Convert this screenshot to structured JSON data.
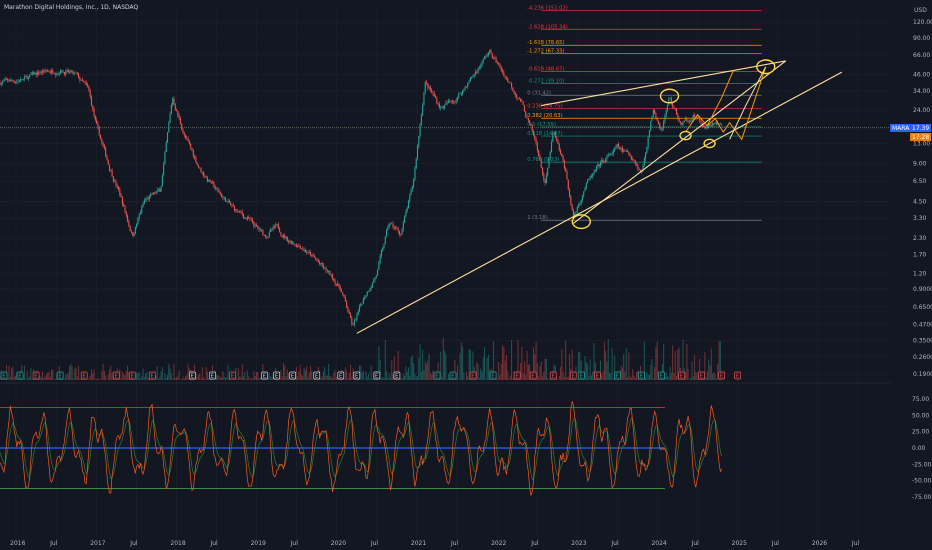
{
  "header": {
    "title": "Marathon Digital Holdings, Inc., 1D, NASDAQ",
    "currency": "USD"
  },
  "price_badge": {
    "symbol": "MARA",
    "value": "17.39",
    "sub_value": "17.28"
  },
  "colors": {
    "background": "#131722",
    "grid": "#1e222d",
    "candle_up": "#26a69a",
    "candle_down": "#ef5350",
    "trendline": "#ffe0a0",
    "circles": "#ffd740",
    "projection": "#ff9800",
    "fib_red": "#f23645",
    "fib_orange": "#ff9800",
    "fib_green": "#089981",
    "fib_gray": "#787b86",
    "osc_line": "#ff5a1f",
    "osc_signal": "#2e7d32",
    "osc_mid": "#2962ff",
    "osc_upper": "#f23645",
    "osc_lower": "#4caf50",
    "badge_blue": "#2962ff",
    "badge_orange": "#f57c00"
  },
  "chart_data": {
    "type": "candlestick",
    "scale": "log",
    "y_ticks": [
      "120.00",
      "90.00",
      "66.00",
      "46.00",
      "34.00",
      "24.00",
      "17.00",
      "13.00",
      "9.00",
      "6.50",
      "4.50",
      "3.30",
      "2.30",
      "1.70",
      "1.20",
      "0.9000",
      "0.6500",
      "0.4700",
      "0.3500",
      "0.2600",
      "0.1900"
    ],
    "y_tick_values": [
      120,
      90,
      66,
      46,
      34,
      24,
      17,
      13,
      9,
      6.5,
      4.5,
      3.3,
      2.3,
      1.7,
      1.2,
      0.9,
      0.65,
      0.47,
      0.35,
      0.26,
      0.19
    ],
    "ylim": [
      0.17,
      150
    ],
    "x_ticks": [
      "2016",
      "Jul",
      "2017",
      "Jul",
      "2018",
      "Jul",
      "2019",
      "Jul",
      "2020",
      "Jul",
      "2021",
      "Jul",
      "2022",
      "Jul",
      "2023",
      "Jul",
      "2024",
      "Jul",
      "2025",
      "Jul",
      "2026",
      "Jul"
    ],
    "x_tick_years": [
      2016,
      2016.5,
      2017,
      2017.5,
      2018,
      2018.5,
      2019,
      2019.5,
      2020,
      2020.5,
      2021,
      2021.5,
      2022,
      2022.5,
      2023,
      2023.5,
      2024,
      2024.5,
      2025,
      2025.5,
      2026,
      2026.5
    ],
    "xlim": [
      2015.8,
      2026.9
    ],
    "price_path": [
      [
        2015.8,
        40
      ],
      [
        2016.1,
        42
      ],
      [
        2016.3,
        48
      ],
      [
        2016.55,
        50
      ],
      [
        2016.75,
        45
      ],
      [
        2016.9,
        35
      ],
      [
        2017.0,
        18
      ],
      [
        2017.15,
        9
      ],
      [
        2017.3,
        5
      ],
      [
        2017.45,
        2.4
      ],
      [
        2017.6,
        4.5
      ],
      [
        2017.8,
        5.5
      ],
      [
        2017.95,
        30
      ],
      [
        2018.1,
        15
      ],
      [
        2018.3,
        8
      ],
      [
        2018.5,
        5.5
      ],
      [
        2018.7,
        4
      ],
      [
        2018.9,
        3.2
      ],
      [
        2019.1,
        2.4
      ],
      [
        2019.25,
        2.8
      ],
      [
        2019.4,
        2.2
      ],
      [
        2019.55,
        2.0
      ],
      [
        2019.75,
        1.5
      ],
      [
        2019.95,
        1.1
      ],
      [
        2020.05,
        0.9
      ],
      [
        2020.2,
        0.45
      ],
      [
        2020.35,
        0.8
      ],
      [
        2020.5,
        1.2
      ],
      [
        2020.65,
        3.0
      ],
      [
        2020.8,
        2.5
      ],
      [
        2020.95,
        6
      ],
      [
        2021.1,
        40
      ],
      [
        2021.3,
        25
      ],
      [
        2021.5,
        30
      ],
      [
        2021.7,
        45
      ],
      [
        2021.9,
        70
      ],
      [
        2022.1,
        45
      ],
      [
        2022.3,
        28
      ],
      [
        2022.5,
        12
      ],
      [
        2022.6,
        6
      ],
      [
        2022.7,
        16
      ],
      [
        2022.85,
        8
      ],
      [
        2022.95,
        3.3
      ],
      [
        2023.1,
        6
      ],
      [
        2023.3,
        9
      ],
      [
        2023.5,
        12
      ],
      [
        2023.7,
        10
      ],
      [
        2023.8,
        7.5
      ],
      [
        2023.95,
        25
      ],
      [
        2024.05,
        17
      ],
      [
        2024.15,
        30
      ],
      [
        2024.3,
        18
      ],
      [
        2024.45,
        22
      ],
      [
        2024.6,
        17
      ],
      [
        2024.7,
        19
      ],
      [
        2024.8,
        17.4
      ]
    ],
    "fib_levels": [
      {
        "label": "-4.236 (151.02)",
        "value": 151.02,
        "color": "#f23645"
      },
      {
        "label": "-2.618 (105.34)",
        "value": 105.34,
        "color": "#f23645"
      },
      {
        "label": "-1.618 (78.65)",
        "value": 78.65,
        "color": "#ff9800"
      },
      {
        "label": "-1.272 (67.33)",
        "value": 67.33,
        "color": "#ff9800"
      },
      {
        "label": "-0.618 (48.67)",
        "value": 48.67,
        "color": "#f23645"
      },
      {
        "label": "-0.272 (39.10)",
        "value": 39.1,
        "color": "#089981"
      },
      {
        "label": "0 (31.42)",
        "value": 31.42,
        "color": "#787b86"
      },
      {
        "label": "0.236 (24.75)",
        "value": 24.75,
        "color": "#f23645"
      },
      {
        "label": "0.382 (20.63)",
        "value": 20.63,
        "color": "#ff9800"
      },
      {
        "label": "0.5 (17.59)",
        "value": 17.59,
        "color": "#089981"
      },
      {
        "label": "0.618 (14.87)",
        "value": 14.87,
        "color": "#089981"
      },
      {
        "label": "0.786 (9.23)",
        "value": 9.23,
        "color": "#089981"
      },
      {
        "label": "1 (3.18)",
        "value": 3.18,
        "color": "#787b86"
      }
    ],
    "trendlines": [
      {
        "from": [
          2020.25,
          0.4
        ],
        "to": [
          2026.3,
          48
        ]
      },
      {
        "from": [
          2022.95,
          3.0
        ],
        "to": [
          2025.6,
          59
        ]
      },
      {
        "from": [
          2022.55,
          26
        ],
        "to": [
          2025.6,
          59
        ]
      }
    ],
    "circled_points": [
      [
        2023.05,
        3.1
      ],
      [
        2024.15,
        31
      ],
      [
        2025.35,
        53
      ],
      [
        2024.35,
        15
      ],
      [
        2024.65,
        13
      ]
    ],
    "projection_path": [
      [
        2024.35,
        16
      ],
      [
        2024.5,
        22
      ],
      [
        2024.62,
        18
      ],
      [
        2024.72,
        20.5
      ],
      [
        2024.82,
        16
      ],
      [
        2024.9,
        19
      ],
      [
        2025.05,
        14
      ],
      [
        2025.35,
        53
      ]
    ],
    "oscillator": {
      "y_ticks": [
        "75.00",
        "50.00",
        "25.00",
        "0.00",
        "-25.00",
        "-50.00",
        "-75.00"
      ],
      "y_tick_values": [
        75,
        50,
        25,
        0,
        -25,
        -50,
        -75
      ],
      "ylim": [
        -95,
        95
      ],
      "levels": {
        "upper": 62,
        "mid": 0,
        "lower": -62
      }
    },
    "events": [
      {
        "year": 2015.85,
        "kind": "E",
        "color": "#26a69a"
      },
      {
        "year": 2016.05,
        "kind": "E",
        "color": "#26a69a"
      },
      {
        "year": 2016.25,
        "kind": "E",
        "color": "#ef5350"
      },
      {
        "year": 2016.55,
        "kind": "E",
        "color": "#26a69a"
      },
      {
        "year": 2016.85,
        "kind": "E",
        "color": "#ef5350"
      },
      {
        "year": 2017.25,
        "kind": "E",
        "color": "#ef5350"
      },
      {
        "year": 2017.45,
        "kind": "E",
        "color": "#ef5350"
      },
      {
        "year": 2017.7,
        "kind": "E",
        "color": "#ef5350"
      },
      {
        "year": 2018.2,
        "kind": "E",
        "color": "#d1d4dc"
      },
      {
        "year": 2018.45,
        "kind": "E",
        "color": "#d1d4dc"
      },
      {
        "year": 2018.7,
        "kind": "E",
        "color": "#ef5350"
      },
      {
        "year": 2019.1,
        "kind": "E",
        "color": "#d1d4dc"
      },
      {
        "year": 2019.25,
        "kind": "E",
        "color": "#d1d4dc"
      },
      {
        "year": 2019.45,
        "kind": "E",
        "color": "#d1d4dc"
      },
      {
        "year": 2019.75,
        "kind": "E",
        "color": "#d1d4dc"
      },
      {
        "year": 2020.05,
        "kind": "E",
        "color": "#d1d4dc"
      },
      {
        "year": 2020.25,
        "kind": "E",
        "color": "#d1d4dc"
      },
      {
        "year": 2020.5,
        "kind": "E",
        "color": "#d1d4dc"
      },
      {
        "year": 2020.75,
        "kind": "E",
        "color": "#d1d4dc"
      },
      {
        "year": 2021.25,
        "kind": "E",
        "color": "#26a69a"
      },
      {
        "year": 2021.45,
        "kind": "E",
        "color": "#26a69a"
      },
      {
        "year": 2021.7,
        "kind": "E",
        "color": "#ef5350"
      },
      {
        "year": 2021.95,
        "kind": "E",
        "color": "#26a69a"
      },
      {
        "year": 2022.25,
        "kind": "E",
        "color": "#ef5350"
      },
      {
        "year": 2022.45,
        "kind": "E",
        "color": "#ef5350"
      },
      {
        "year": 2022.7,
        "kind": "E",
        "color": "#ef5350"
      },
      {
        "year": 2022.95,
        "kind": "E",
        "color": "#ef5350"
      },
      {
        "year": 2023.05,
        "kind": "E",
        "color": "#26a69a"
      },
      {
        "year": 2023.25,
        "kind": "E",
        "color": "#ef5350"
      },
      {
        "year": 2023.5,
        "kind": "E",
        "color": "#26a69a"
      },
      {
        "year": 2023.8,
        "kind": "E",
        "color": "#26a69a"
      },
      {
        "year": 2024.05,
        "kind": "E",
        "color": "#26a69a"
      },
      {
        "year": 2024.3,
        "kind": "E",
        "color": "#ef5350"
      },
      {
        "year": 2024.55,
        "kind": "E",
        "color": "#ef5350"
      },
      {
        "year": 2024.8,
        "kind": "E",
        "color": "#ef5350"
      },
      {
        "year": 2025.0,
        "kind": "E",
        "color": "#ef5350"
      }
    ]
  }
}
